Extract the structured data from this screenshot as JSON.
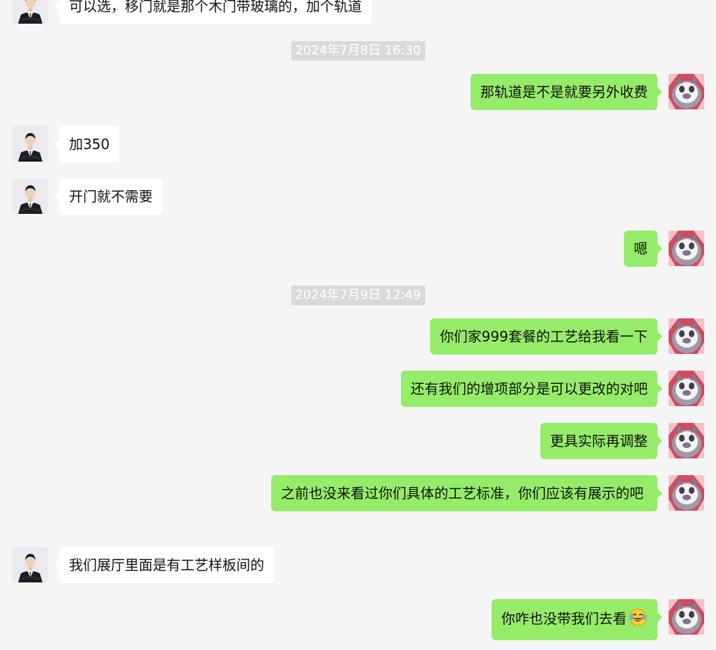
{
  "colors": {
    "background": "#f5f5f5",
    "outgoing_bubble": "#95ec69",
    "incoming_bubble": "#ffffff",
    "timestamp_bg": "#dadada"
  },
  "messages": {
    "m0": {
      "text": "可以选，移门就是那个木门带玻璃的，加个轨道",
      "direction": "incoming"
    },
    "ts1": "2024年7月8日 16:30",
    "m1": {
      "text": "那轨道是不是就要另外收费",
      "direction": "outgoing"
    },
    "m2": {
      "text": "加350",
      "direction": "incoming"
    },
    "m3": {
      "text": "开门就不需要",
      "direction": "incoming"
    },
    "m4": {
      "text": "嗯",
      "direction": "outgoing"
    },
    "ts2": "2024年7月9日 12:49",
    "m5": {
      "text": "你们家999套餐的工艺给我看一下",
      "direction": "outgoing"
    },
    "m6": {
      "text": "还有我们的增项部分是可以更改的对吧",
      "direction": "outgoing"
    },
    "m7": {
      "text": "更具实际再调整",
      "direction": "outgoing"
    },
    "m8": {
      "text": "之前也没来看过你们具体的工艺标准，你们应该有展示的吧",
      "direction": "outgoing"
    },
    "m9": {
      "text": "我们展厅里面是有工艺样板间的",
      "direction": "incoming"
    },
    "m10": {
      "text": "你咋也没带我们去看",
      "direction": "outgoing",
      "emoji": "laughing-crying-emoji"
    }
  }
}
